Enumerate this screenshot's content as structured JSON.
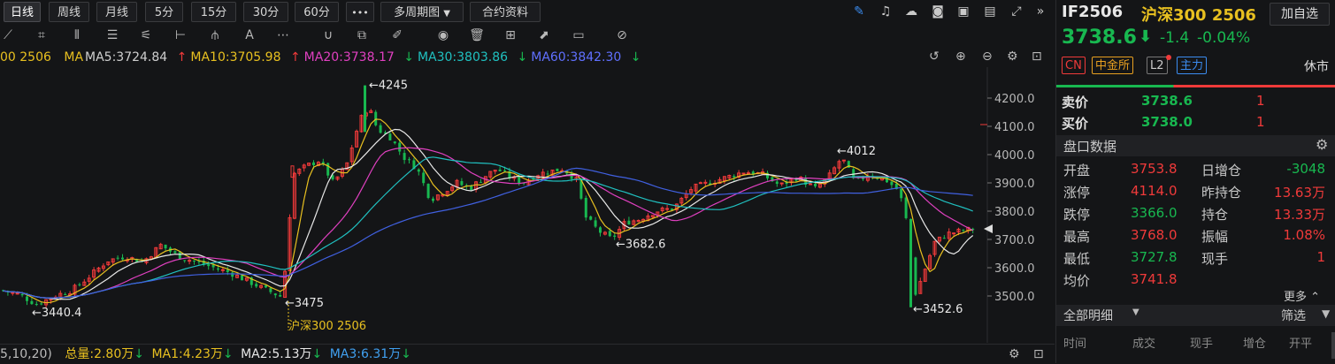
{
  "toolbar": {
    "period_tabs": [
      "日线",
      "周线",
      "月线",
      "5分",
      "15分",
      "30分",
      "60分"
    ],
    "more_label": "•••",
    "multi_period_label": "多周期图",
    "contract_info_label": "合约资料"
  },
  "legend": {
    "prefix": "00 2506",
    "ma_label": "MA",
    "ma5": "MA5:3724.84",
    "ma10": "MA10:3705.98",
    "ma20": "MA20:3738.17",
    "ma30": "MA30:3803.86",
    "ma60": "MA60:3842.30"
  },
  "chart": {
    "y_ticks": [
      "4200.0",
      "4100.0",
      "4000.0",
      "3900.0",
      "3800.0",
      "3700.0",
      "3600.0",
      "3500.0"
    ],
    "annotations": {
      "high": "←4245",
      "peak2": "←4012",
      "low1": "←3440.4",
      "low2": "←3475",
      "low3": "←3682.6",
      "low4": "←3452.6"
    },
    "contract_label": "沪深300 2506"
  },
  "volume": {
    "params": "5,10,20)",
    "total": "总量:2.80万",
    "ma1": "MA1:4.23万",
    "ma2": "MA2:5.13万",
    "ma3": "MA3:6.31万"
  },
  "quote": {
    "code": "IF2506",
    "name": "沪深300 2506",
    "add_btn": "加自选",
    "price": "3738.6",
    "change": "-1.4",
    "change_pct": "-0.04%",
    "tags": [
      "CN",
      "中金所",
      "L2",
      "主力"
    ],
    "status": "休市",
    "ask_label": "卖价",
    "ask_price": "3738.6",
    "ask_vol": "1",
    "bid_label": "买价",
    "bid_price": "3738.0",
    "bid_vol": "1",
    "section_title": "盘口数据",
    "stats": [
      {
        "l1": "开盘",
        "v1": "3753.8",
        "l2": "日增仓",
        "v2": "-3048"
      },
      {
        "l1": "涨停",
        "v1": "4114.0",
        "l2": "昨持仓",
        "v2": "13.63万"
      },
      {
        "l1": "跌停",
        "v1": "3366.0",
        "l2": "持仓",
        "v2": "13.33万"
      },
      {
        "l1": "最高",
        "v1": "3768.0",
        "l2": "振幅",
        "v2": "1.08%"
      },
      {
        "l1": "最低",
        "v1": "3727.8",
        "l2": "现手",
        "v2": "1"
      },
      {
        "l1": "均价",
        "v1": "3741.8",
        "l2": "",
        "v2": ""
      }
    ],
    "more_label": "更多",
    "detail_tab": "全部明细",
    "filter_label": "筛选",
    "detail_headers": [
      "时间",
      "成交",
      "现手",
      "增仓",
      "开平"
    ]
  },
  "colors": {
    "up": "#f03a3a",
    "down": "#18b850",
    "ma5": "#e8e8e8",
    "ma10": "#e8c020",
    "ma20": "#e040c0",
    "ma30": "#20c0c0",
    "ma60": "#4060e0"
  }
}
